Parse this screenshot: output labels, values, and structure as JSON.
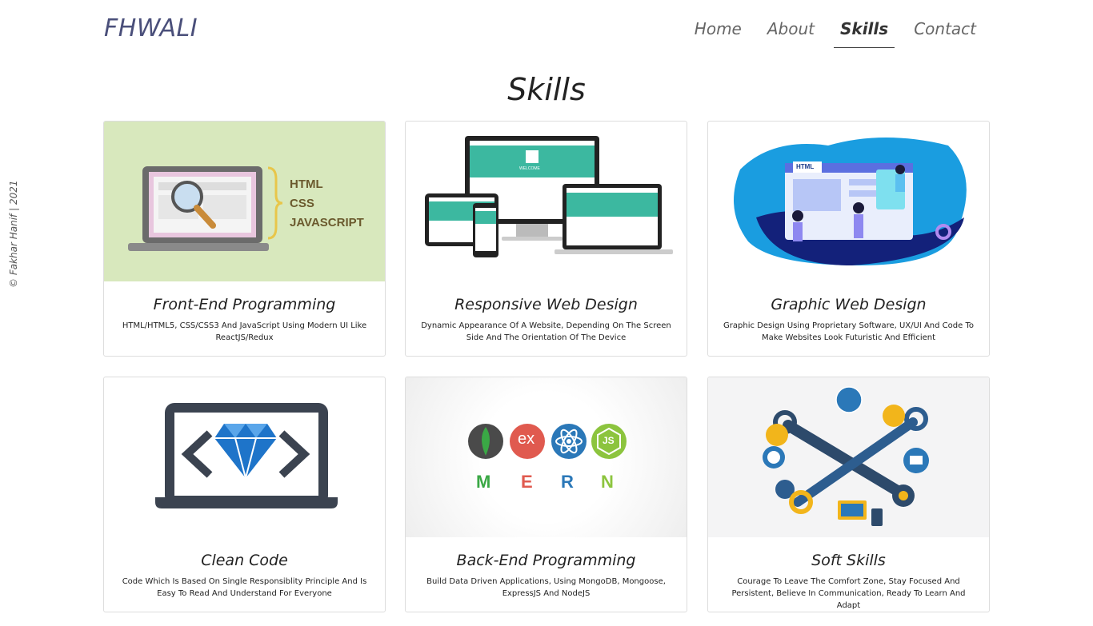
{
  "credit": "© Fakhar Hanif | 2021",
  "brand": "FHWALI",
  "nav": [
    {
      "label": "Home",
      "active": false
    },
    {
      "label": "About",
      "active": false
    },
    {
      "label": "Skills",
      "active": true
    },
    {
      "label": "Contact",
      "active": false
    }
  ],
  "page_title": "Skills",
  "cards": [
    {
      "title": "Front-End Programming",
      "description": "HTML/HTML5, CSS/CSS3 And JavaScript Using Modern UI Like ReactJS/Redux",
      "image_text": [
        "HTML",
        "CSS",
        "JAVASCRIPT"
      ]
    },
    {
      "title": "Responsive Web Design",
      "description": "Dynamic Appearance Of A Website, Depending On The Screen Side And The Orientation Of The Device",
      "image_text": [
        "WELCOME"
      ]
    },
    {
      "title": "Graphic Web Design",
      "description": "Graphic Design Using Proprietary Software, UX/UI And Code To Make Websites Look Futuristic And Efficient",
      "image_text": [
        "HTML"
      ]
    },
    {
      "title": "Clean Code",
      "description": "Code Which Is Based On Single Responsiblity Principle And Is Easy To Read And Understand For Everyone",
      "image_text": []
    },
    {
      "title": "Back-End Programming",
      "description": "Build Data Driven Applications, Using MongoDB, Mongoose, ExpressJS And NodeJS",
      "image_text": [
        "ex",
        "JS",
        "M",
        "E",
        "R",
        "N"
      ]
    },
    {
      "title": "Soft Skills",
      "description": "Courage To Leave The Comfort Zone, Stay Focused And Persistent, Believe In Communication, Ready To Learn And Adapt",
      "image_text": []
    }
  ],
  "colors": {
    "brand": "#4a4f7a",
    "frontend_bg": "#d8e8bd",
    "teal": "#3cb8a0",
    "mern_green": "#3aa845",
    "mern_red": "#e05a4f",
    "mern_blue": "#2b78b8",
    "mern_lime": "#8cc43e"
  }
}
